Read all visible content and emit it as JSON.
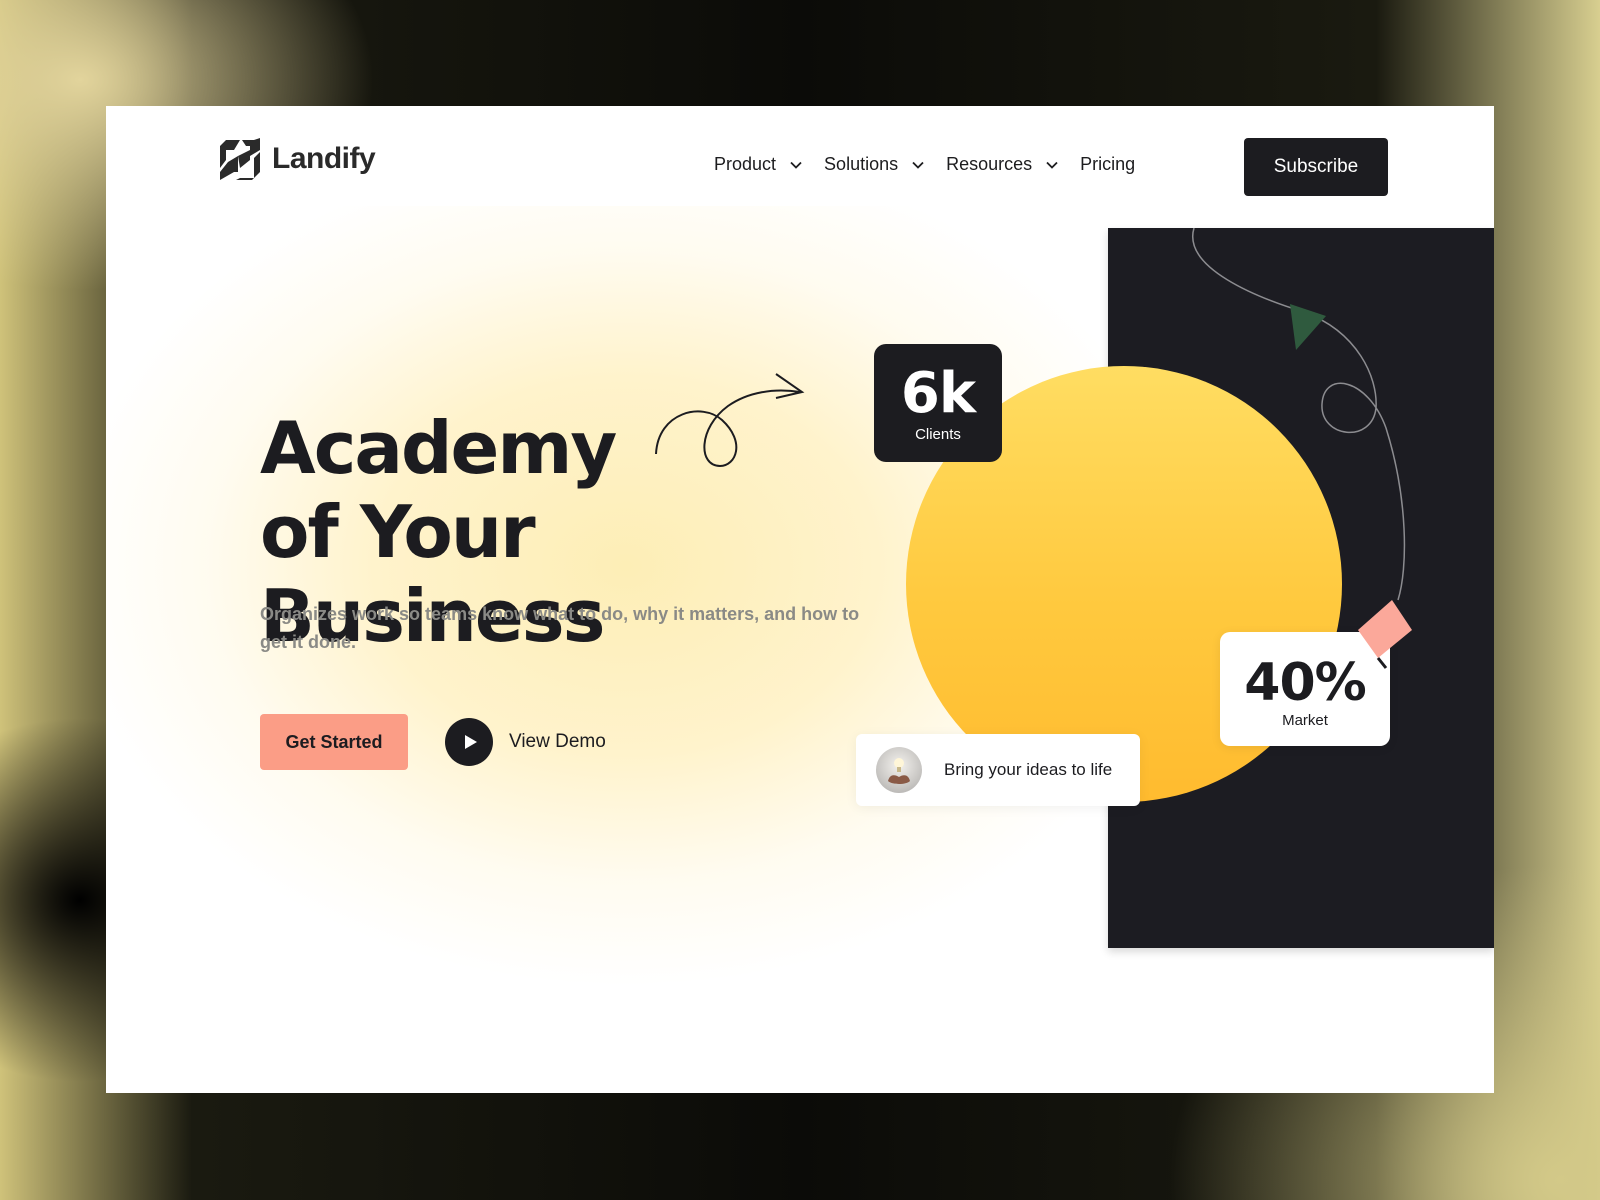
{
  "brand": {
    "name": "Landify"
  },
  "nav": {
    "items": [
      {
        "label": "Product",
        "has_dropdown": true
      },
      {
        "label": "Solutions",
        "has_dropdown": true
      },
      {
        "label": "Resources",
        "has_dropdown": true
      },
      {
        "label": "Pricing",
        "has_dropdown": false
      }
    ],
    "subscribe_label": "Subscribe"
  },
  "hero": {
    "headline_line1": "Academy",
    "headline_line2": "of Your Business",
    "subtext": "Organizes  work so teams know what to do, why it matters, and how to get it done.",
    "primary_cta": "Get Started",
    "secondary_cta": "View Demo"
  },
  "stats": {
    "clients": {
      "value": "6k",
      "label": "Clients"
    },
    "market": {
      "value": "40%",
      "label": "Market"
    }
  },
  "idea_card": {
    "text": "Bring your ideas to life"
  },
  "colors": {
    "accent_pink": "#fb9d86",
    "accent_yellow": "#ffc93e",
    "dark": "#1c1c20",
    "arrow_green": "#2f5a3e"
  },
  "icons": [
    "logo-mark-icon",
    "chevron-down-icon",
    "play-icon",
    "curl-arrow-icon",
    "lightbulb-hand-icon"
  ]
}
